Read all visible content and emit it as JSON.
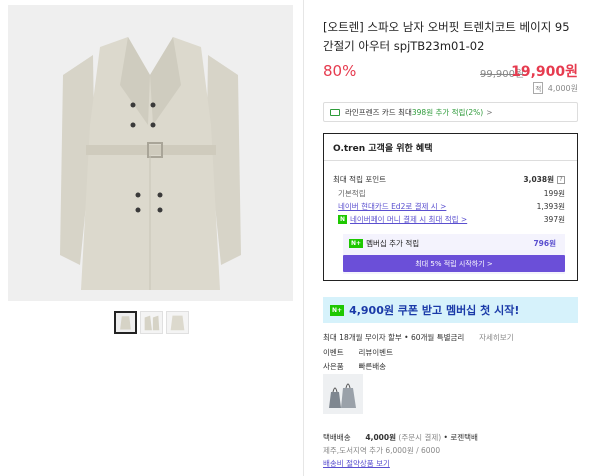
{
  "product": {
    "title": "[오트렌] 스파오 남자 오버핏 트렌치코트 베이지 95 간절기 아우터 spjTB23m01-02",
    "discount": "80%",
    "original_price": "99,900원",
    "price": "19,900원",
    "points_badge": "적",
    "points": "4,000원"
  },
  "images": {
    "thumbnails": [
      "thumb-1",
      "thumb-2",
      "thumb-3"
    ],
    "selected_thumbnail": 1
  },
  "card_banner": {
    "prefix": "라인프렌즈 카드 최대 ",
    "highlight": "398원 추가 적립(2%)",
    "chevron": ">"
  },
  "benefit": {
    "header": "O.tren 고객을 위한 혜택",
    "rows": [
      {
        "label": "최대 적립 포인트",
        "value": "3,038원",
        "help": "?"
      },
      {
        "label": "기본적립",
        "value": "199원"
      },
      {
        "label": "네이버 현대카드 Ed2로 결제 시 >",
        "value": "1,393원"
      },
      {
        "label": "네이버페이 머니 결제 시 최대 적립 >",
        "value": "397원",
        "badge": "N"
      }
    ],
    "member_badge": "N+",
    "member_label": "멤버십 추가 적립",
    "member_value": "796원",
    "member_button": "최대 5% 적립 시작하기 >"
  },
  "coupon_banner": {
    "badge": "N+",
    "text": "4,900원 쿠폰 받고 멤버십 첫 시작!"
  },
  "info": {
    "installment": "최대 18개월 무이자 할부 • 60개월 특별금리",
    "installment_link": "자세히보기",
    "event_label": "이벤트",
    "event_value": "리뷰이벤트",
    "gift_label": "사은품",
    "gift_value": "빠른배송",
    "shipping_label": "택배배송",
    "shipping_fee": "4,000원",
    "shipping_note": "(주문시 결제)",
    "shipping_carrier": "• 로젠택배",
    "jeju_note": "제주,도서지역 추가 6,000원 / 6000",
    "return_link": "배송비 절약상품 보기"
  }
}
